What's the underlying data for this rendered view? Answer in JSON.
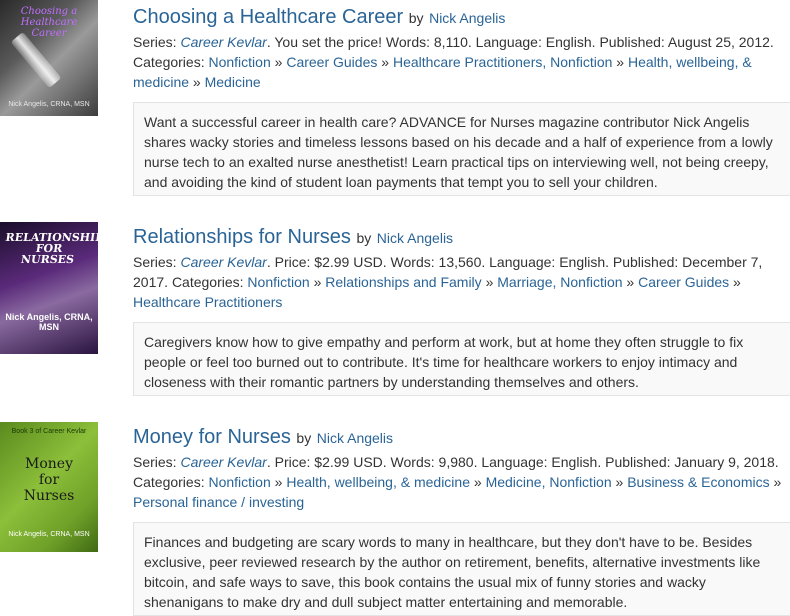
{
  "books": [
    {
      "cover": {
        "title_lines": [
          "Choosing a",
          "Healthcare Career"
        ],
        "author": "Nick Angelis, CRNA, MSN"
      },
      "title": "Choosing a Healthcare Career",
      "by": "by",
      "author": "Nick Angelis",
      "series_label": "Series:",
      "series": "Career Kevlar",
      "meta_text": ". You set the price! Words: 8,110. Language: English. Published: August 25, 2012.",
      "categories_label": "Categories:",
      "categories": [
        "Nonfiction",
        "Career Guides",
        "Healthcare Practitioners, Nonfiction",
        "Health, wellbeing, & medicine",
        "Medicine"
      ],
      "description": "Want a successful career in health care? ADVANCE for Nurses magazine contributor Nick Angelis shares wacky stories and timeless lessons based on his decade and a half of experience from a lowly nurse tech to an exalted nurse anesthetist! Learn practical tips on interviewing well, not being creepy, and avoiding the kind of student loan payments that tempt you to sell your children."
    },
    {
      "cover": {
        "title_lines": [
          "RELATIONSHIPS FOR",
          "NURSES"
        ],
        "author": "Nick Angelis, CRNA, MSN"
      },
      "title": "Relationships for Nurses",
      "by": "by",
      "author": "Nick Angelis",
      "series_label": "Series:",
      "series": "Career Kevlar",
      "meta_text": ". Price: $2.99 USD. Words: 13,560. Language: English. Published: December 7, 2017.",
      "categories_label": "Categories:",
      "categories": [
        "Nonfiction",
        "Relationships and Family",
        "Marriage, Nonfiction",
        "Career Guides",
        "Healthcare Practitioners"
      ],
      "description": "Caregivers know how to give empathy and perform at work, but at home they often struggle to fix people or feel too burned out to contribute. It's time for healthcare workers to enjoy intimacy and closeness with their romantic partners by understanding themselves and others."
    },
    {
      "cover": {
        "tag": "Book 3 of Career Kevlar",
        "title_lines": [
          "Money",
          "for",
          "Nurses"
        ],
        "author": "Nick Angelis, CRNA, MSN"
      },
      "title": "Money for Nurses",
      "by": "by",
      "author": "Nick Angelis",
      "series_label": "Series:",
      "series": "Career Kevlar",
      "meta_text": ". Price: $2.99 USD. Words: 9,980. Language: English. Published: January 9, 2018.",
      "categories_label": "Categories:",
      "categories": [
        "Nonfiction",
        "Health, wellbeing, & medicine",
        "Medicine, Nonfiction",
        "Business & Economics",
        "Personal finance / investing"
      ],
      "description": "Finances and budgeting are scary words to many in healthcare, but they don't have to be. Besides exclusive, peer reviewed research by the author on retirement, benefits, alternative investments like bitcoin, and safe ways to save, this book contains the usual mix of funny stories and wacky shenanigans to make dry and dull subject matter entertaining and memorable."
    }
  ],
  "category_separator": "»"
}
